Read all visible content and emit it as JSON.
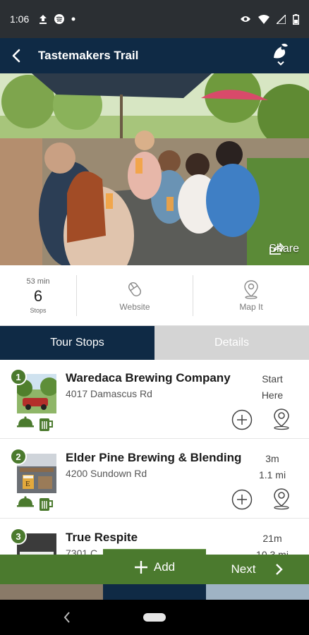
{
  "status_bar": {
    "time": "1:06"
  },
  "header": {
    "title": "Tastemakers Trail"
  },
  "hero": {
    "share_label": "Share"
  },
  "info": {
    "duration": "53 min",
    "stops_count": "6",
    "stops_label": "Stops",
    "website_label": "Website",
    "map_label": "Map It"
  },
  "tabs": [
    {
      "label": "Tour Stops",
      "active": true
    },
    {
      "label": "Details",
      "active": false
    }
  ],
  "stops": [
    {
      "number": "1",
      "name": "Waredaca Brewing Company",
      "address": "4017 Damascus Rd",
      "eta_line1": "Start",
      "eta_line2": "Here"
    },
    {
      "number": "2",
      "name": "Elder Pine Brewing & Blending",
      "address": "4200 Sundown Rd",
      "eta_line1": "3m",
      "eta_line2": "1.1 mi"
    },
    {
      "number": "3",
      "name": "True Respite",
      "address": "7301 C...",
      "eta_line1": "21m",
      "eta_line2": "10.3 mi"
    }
  ],
  "actions": {
    "add_label": "Add",
    "next_label": "Next"
  },
  "colors": {
    "navy": "#0f2a45",
    "green": "#4b7a2e",
    "tab_inactive": "#d4d4d4"
  },
  "icons": [
    "back-arrow-icon",
    "brand-logo-icon",
    "share-icon",
    "mouse-icon",
    "map-pin-icon",
    "plus-icon",
    "chevron-right-icon",
    "food-cloche-icon",
    "beer-mug-icon"
  ]
}
